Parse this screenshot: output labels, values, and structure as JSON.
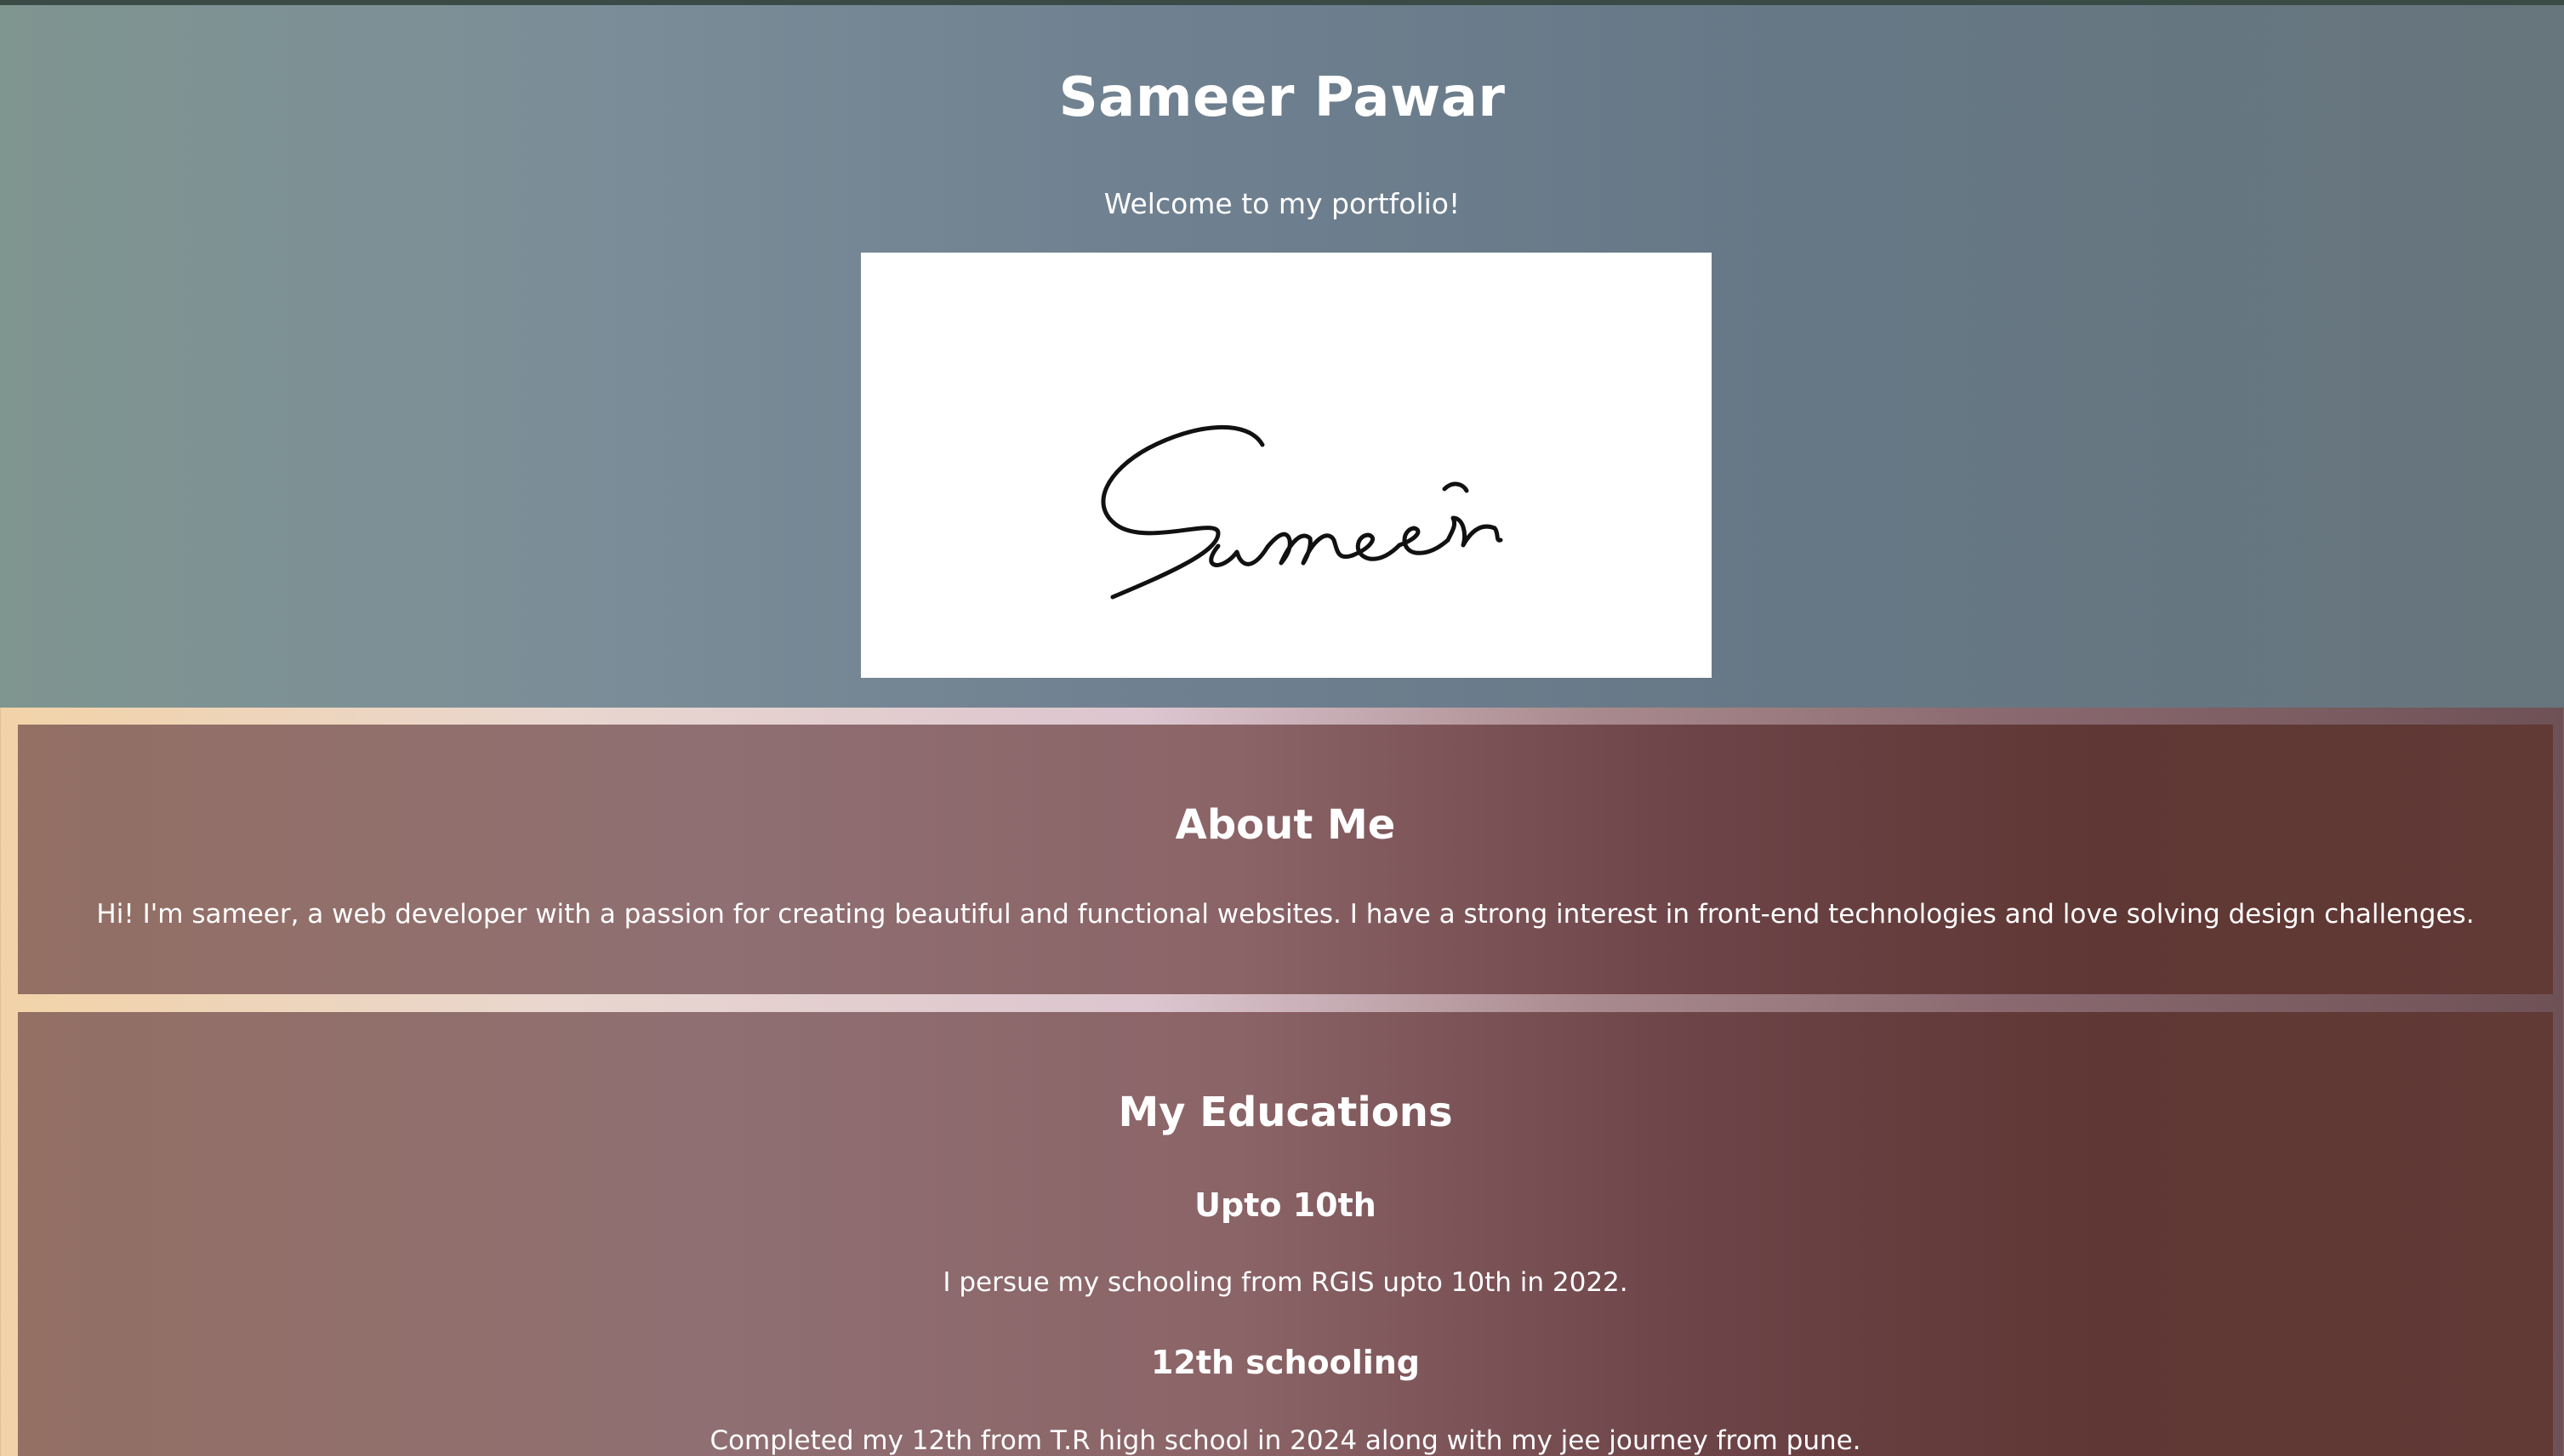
{
  "header": {
    "title": "Sameer Pawar",
    "tagline": "Welcome to my portfolio!",
    "signature_text": "Sameer"
  },
  "about": {
    "heading": "About Me",
    "text": "Hi! I'm sameer, a web developer with a passion for creating beautiful and functional websites. I have a strong interest in front-end technologies and love solving design challenges."
  },
  "education": {
    "heading": "My Educations",
    "items": [
      {
        "title": "Upto 10th",
        "text": "I persue my schooling from RGIS upto 10th in 2022."
      },
      {
        "title": "12th schooling",
        "text": "Completed my 12th from T.R high school in 2024 along with my jee journey from pune."
      }
    ]
  },
  "colors": {
    "header_bg": "#71848f",
    "panel_bg": "#7a5558",
    "text": "#ffffff",
    "signature": "#111111"
  }
}
